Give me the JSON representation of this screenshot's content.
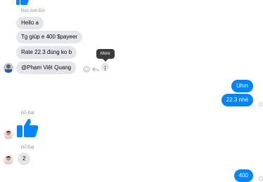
{
  "thread": {
    "sender1_name": "Đức Anh Em",
    "sender2_name": "Đỗ Đạt",
    "sender3_name": "Đỗ Đạt",
    "incoming": [
      "Hello a",
      "Tg giúp e 400 $payeer",
      "Rate 22.3 đúng ko b",
      "@Phạm Việt Quang"
    ],
    "outgoing": [
      "Uhm",
      "22.3 nhé",
      "400"
    ],
    "reply_number": "2"
  },
  "tooltip": {
    "label": "More"
  },
  "icons": {
    "top_like": "like-icon",
    "like": "like-icon",
    "react": "smiley-icon",
    "reply": "reply-arrow-icon",
    "more": "more-vertical-icon",
    "seen": "seen-indicator-icon"
  },
  "colors": {
    "accent": "#0084ff",
    "incoming_bg": "#e4e6eb"
  }
}
